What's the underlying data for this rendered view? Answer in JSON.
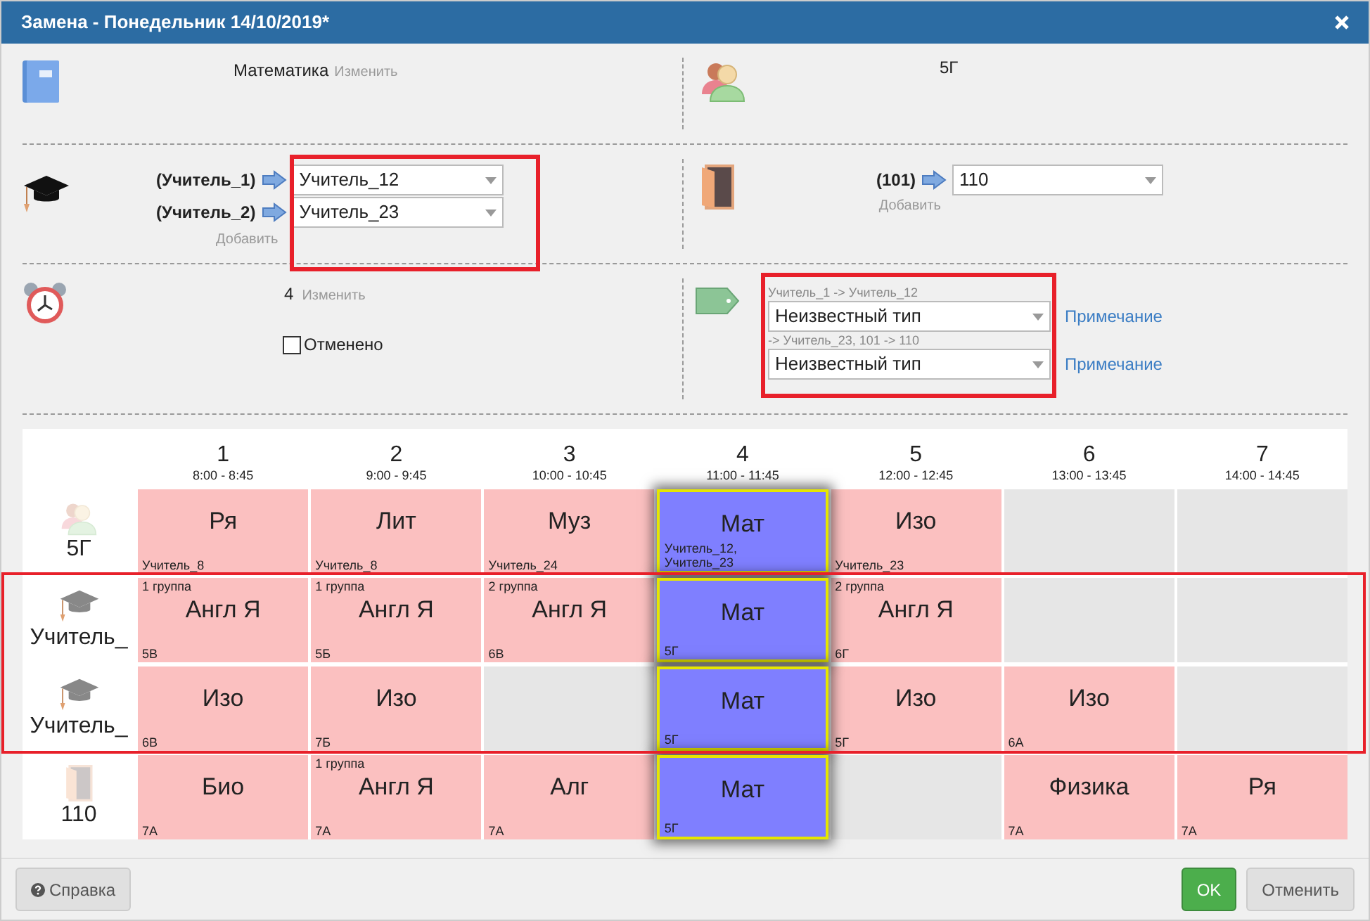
{
  "window": {
    "title": "Замена - Понедельник 14/10/2019*"
  },
  "subject": {
    "value": "Математика",
    "change_link": "Изменить"
  },
  "class": {
    "value": "5Г"
  },
  "teachers": {
    "replacements": [
      {
        "from": "(Учитель_1)",
        "to": "Учитель_12"
      },
      {
        "from": "(Учитель_2)",
        "to": "Учитель_23"
      }
    ],
    "add_link": "Добавить"
  },
  "room": {
    "from": "(101)",
    "to": "110",
    "add_link": "Добавить"
  },
  "lesson": {
    "value": "4",
    "change_link": "Изменить",
    "cancelled": {
      "label": "Отменено",
      "checked": false
    }
  },
  "types": [
    {
      "caption": "Учитель_1 -> Учитель_12",
      "value": "Неизвестный тип",
      "note_link": "Примечание"
    },
    {
      "caption": "-> Учитель_23, 101 -> 110",
      "value": "Неизвестный тип",
      "note_link": "Примечание"
    }
  ],
  "schedule": {
    "periods": [
      {
        "number": "1",
        "time": "8:00 - 8:45"
      },
      {
        "number": "2",
        "time": "9:00 - 9:45"
      },
      {
        "number": "3",
        "time": "10:00 - 10:45"
      },
      {
        "number": "4",
        "time": "11:00 - 11:45"
      },
      {
        "number": "5",
        "time": "12:00 - 12:45"
      },
      {
        "number": "6",
        "time": "13:00 - 13:45"
      },
      {
        "number": "7",
        "time": "14:00 - 14:45"
      }
    ],
    "rows": [
      {
        "label": "5Г",
        "kind": "class",
        "cells": [
          {
            "kind": "lesson",
            "subject": "Ря",
            "bottom": "Учитель_8"
          },
          {
            "kind": "lesson",
            "subject": "Лит",
            "bottom": "Учитель_8"
          },
          {
            "kind": "lesson",
            "subject": "Муз",
            "bottom": "Учитель_24"
          },
          {
            "kind": "current",
            "subject": "Мат",
            "bottom": "Учитель_12,\nУчитель_23"
          },
          {
            "kind": "lesson",
            "subject": "Изо",
            "bottom": "Учитель_23"
          },
          {
            "kind": "empty"
          },
          {
            "kind": "empty"
          }
        ]
      },
      {
        "label": "Учитель_",
        "kind": "teacher",
        "cells": [
          {
            "kind": "lesson",
            "top": "1 группа",
            "subject": "Англ Я",
            "bottom": "5В"
          },
          {
            "kind": "lesson",
            "top": "1 группа",
            "subject": "Англ Я",
            "bottom": "5Б"
          },
          {
            "kind": "lesson",
            "top": "2 группа",
            "subject": "Англ Я",
            "bottom": "6В"
          },
          {
            "kind": "current",
            "subject": "Мат",
            "bottom": "5Г"
          },
          {
            "kind": "lesson",
            "top": "2 группа",
            "subject": "Англ Я",
            "bottom": "6Г"
          },
          {
            "kind": "empty"
          },
          {
            "kind": "empty"
          }
        ]
      },
      {
        "label": "Учитель_",
        "kind": "teacher",
        "cells": [
          {
            "kind": "lesson",
            "subject": "Изо",
            "bottom": "6В"
          },
          {
            "kind": "lesson",
            "subject": "Изо",
            "bottom": "7Б"
          },
          {
            "kind": "empty"
          },
          {
            "kind": "current",
            "subject": "Мат",
            "bottom": "5Г"
          },
          {
            "kind": "lesson",
            "subject": "Изо",
            "bottom": "5Г"
          },
          {
            "kind": "lesson",
            "subject": "Изо",
            "bottom": "6А"
          },
          {
            "kind": "empty"
          }
        ]
      },
      {
        "label": "110",
        "kind": "room",
        "cells": [
          {
            "kind": "lesson",
            "subject": "Био",
            "bottom": "7А"
          },
          {
            "kind": "lesson",
            "top": "1 группа",
            "subject": "Англ Я",
            "bottom": "7А"
          },
          {
            "kind": "lesson",
            "subject": "Алг",
            "bottom": "7А"
          },
          {
            "kind": "current",
            "subject": "Мат",
            "bottom": "5Г"
          },
          {
            "kind": "empty"
          },
          {
            "kind": "lesson",
            "subject": "Физика",
            "bottom": "7А"
          },
          {
            "kind": "lesson",
            "subject": "Ря",
            "bottom": "7А"
          }
        ]
      }
    ]
  },
  "footer": {
    "help": "Справка",
    "ok": "OK",
    "cancel": "Отменить"
  }
}
